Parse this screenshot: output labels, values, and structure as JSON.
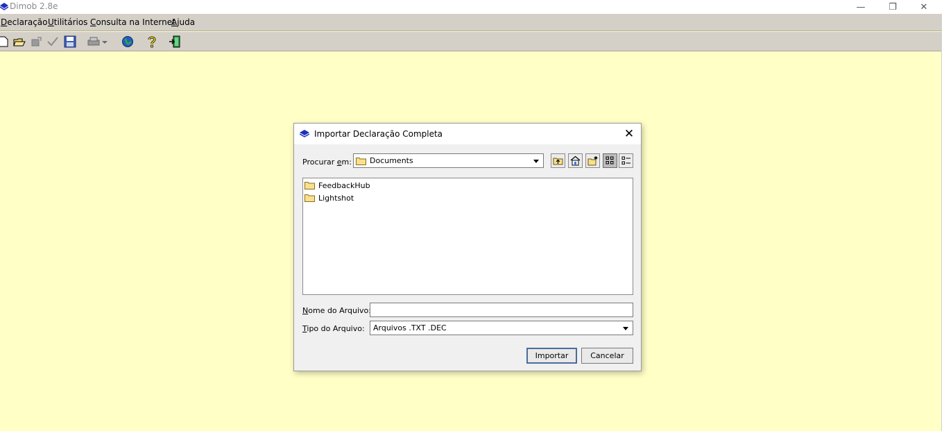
{
  "window": {
    "title": "Dimob 2.8e",
    "minimize_glyph": "—",
    "restore_glyph": "❐",
    "close_glyph": "✕"
  },
  "menu": {
    "items": [
      {
        "first": "D",
        "rest": "eclaração"
      },
      {
        "first": "U",
        "rest": "tilitários"
      },
      {
        "first": "C",
        "rest": "onsulta na Internet"
      },
      {
        "first": "A",
        "rest": "juda"
      }
    ]
  },
  "toolbar": {
    "icons": [
      "new-document-icon",
      "open-folder-icon",
      "save-disabled-icon",
      "check-disabled-icon",
      "save-disk-icon",
      "print-icon",
      "globe-icon",
      "help-icon",
      "exit-icon"
    ]
  },
  "dialog": {
    "title": "Importar Declaração Completa",
    "close_glyph": "✕",
    "look_in_label_pre": "Procurar ",
    "look_in_label_mn": "e",
    "look_in_label_post": "m:",
    "look_in_value": "Documents",
    "files": [
      {
        "name": "FeedbackHub"
      },
      {
        "name": "Lightshot"
      }
    ],
    "filename_label_mn": "N",
    "filename_label_rest": "ome do Arquivo:",
    "filename_value": "",
    "filetype_label_mn": "T",
    "filetype_label_rest": "ipo do Arquivo:",
    "filetype_value": "Arquivos .TXT .DEC",
    "import_button": "Importar",
    "cancel_button": "Cancelar"
  },
  "colors": {
    "background": "#ffffc6",
    "chrome": "#d4d0c8",
    "accent": "#1f2fbf"
  }
}
